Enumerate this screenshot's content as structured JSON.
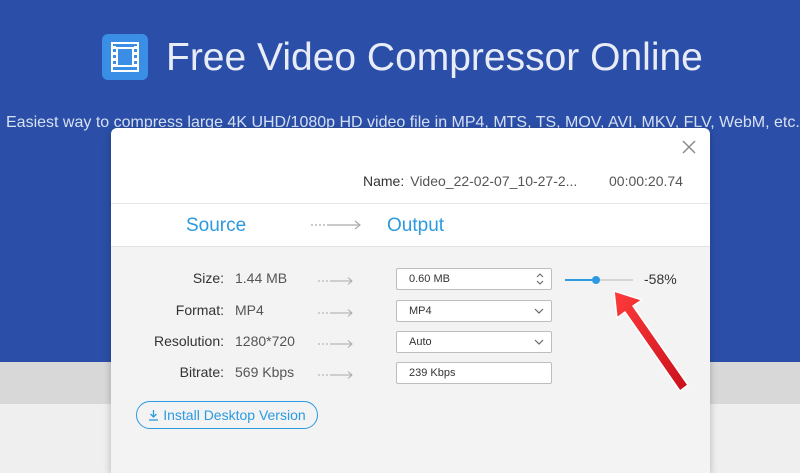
{
  "header": {
    "title": "Free Video Compressor Online",
    "tagline": "Easiest way to compress large 4K UHD/1080p HD video file in MP4, MTS, TS, MOV, AVI, MKV, FLV, WebM, etc. in"
  },
  "dialog": {
    "name_label": "Name:",
    "file_name": "Video_22-02-07_10-27-2...",
    "duration": "00:00:20.74",
    "tabs": {
      "source": "Source",
      "output": "Output"
    },
    "rows": [
      {
        "label": "Size:",
        "source": "1.44 MB",
        "output": "0.60  MB",
        "control": "stepper"
      },
      {
        "label": "Format:",
        "source": "MP4",
        "output": "MP4",
        "control": "dropdown"
      },
      {
        "label": "Resolution:",
        "source": "1280*720",
        "output": "Auto",
        "control": "dropdown"
      },
      {
        "label": "Bitrate:",
        "source": "569 Kbps",
        "output": "239 Kbps",
        "control": "text"
      }
    ],
    "compression": {
      "percent_text": "-58%",
      "slider_level": 0.45
    },
    "install_label": "Install Desktop Version"
  },
  "colors": {
    "hero_bg": "#2b4fa8",
    "accent": "#2b9ae0",
    "annotation_arrow": "#e8182a"
  },
  "icons": {
    "logo": "film-strip-icon",
    "close": "close-icon",
    "install": "download-icon",
    "flow": "arrow-right-icon",
    "stepper": "up-down-chevron-icon",
    "dropdown": "chevron-down-icon"
  }
}
